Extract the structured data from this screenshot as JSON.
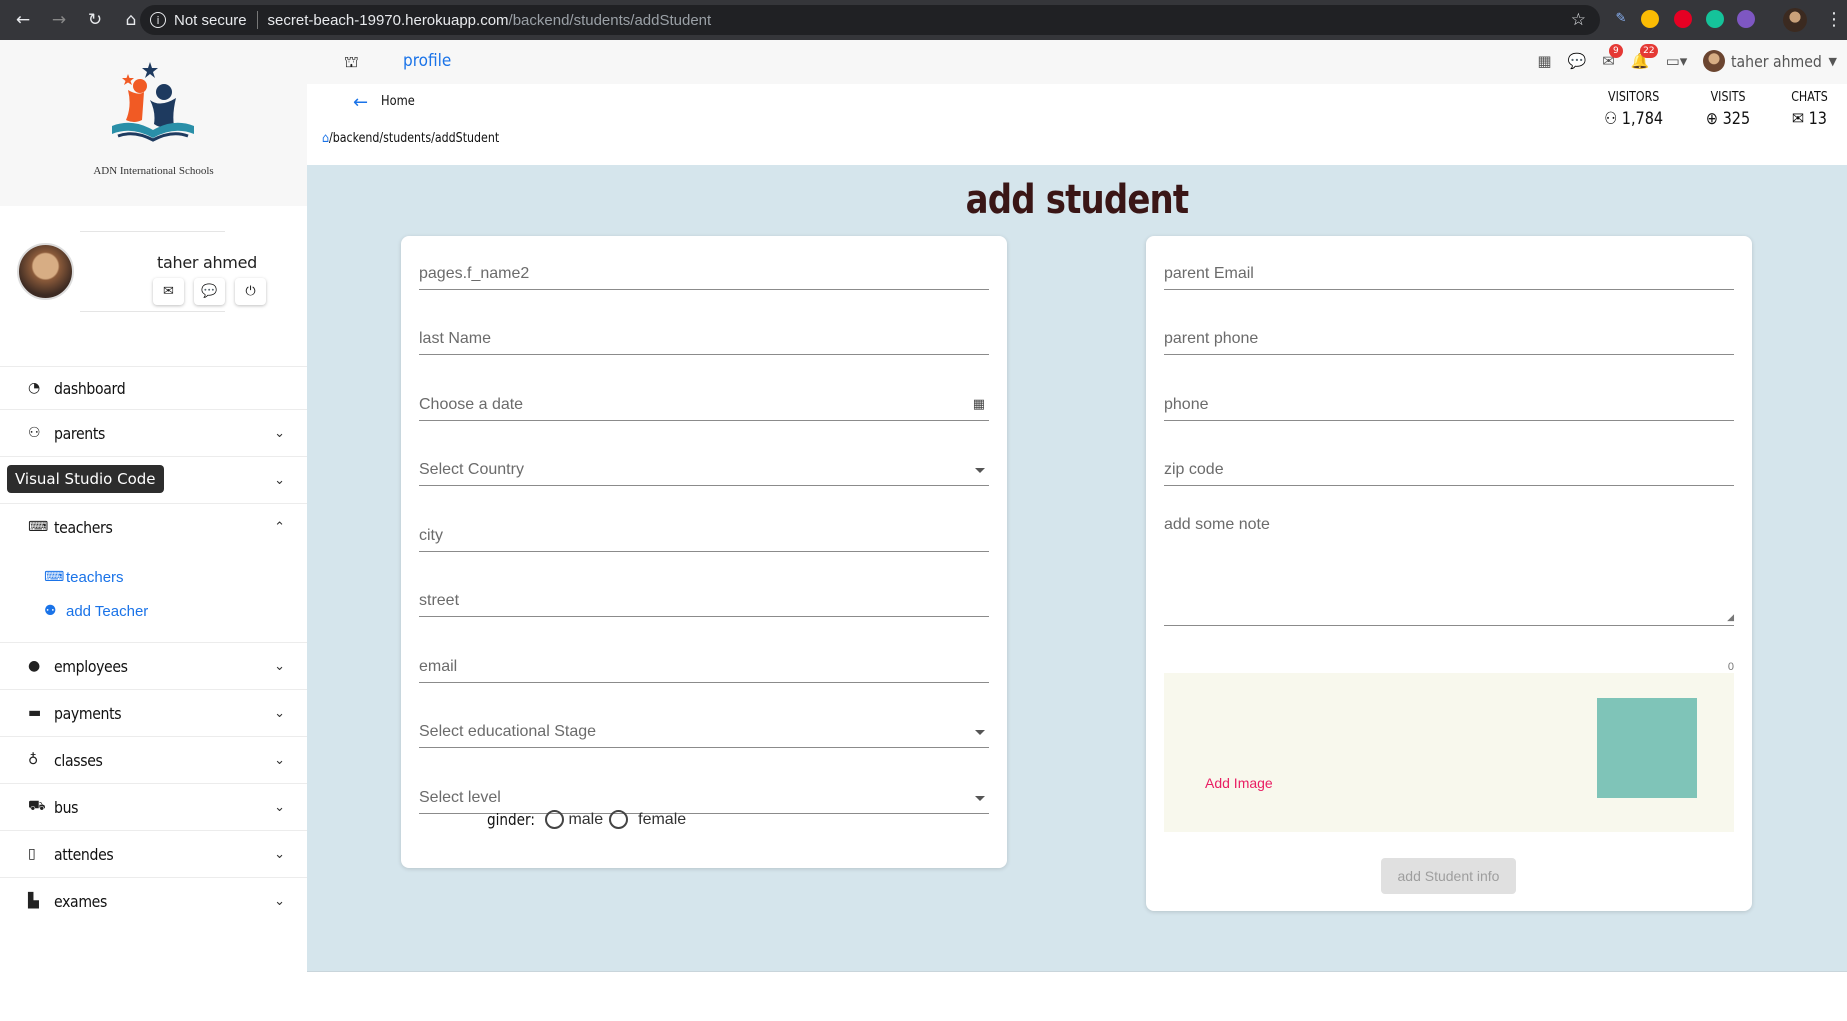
{
  "browser": {
    "security_label": "Not secure",
    "url_host": "secret-beach-19970.herokuapp.com",
    "url_path": "/backend/students/addStudent"
  },
  "sidebar": {
    "school_name": "ADN International Schools",
    "user_name": "taher ahmed",
    "tooltip": "Visual Studio Code",
    "menu": [
      {
        "label": "dashboard",
        "icon": "gauge-icon",
        "glyph": "◔",
        "chevron": ""
      },
      {
        "label": "parents",
        "icon": "users-icon",
        "glyph": "⚇",
        "chevron": "⌄"
      },
      {
        "label": "",
        "icon": "",
        "glyph": "",
        "chevron": "⌄"
      },
      {
        "label": "teachers",
        "icon": "chalkboard-icon",
        "glyph": "⌨",
        "chevron": "⌃"
      },
      {
        "label": "employees",
        "icon": "person-icon",
        "glyph": "●",
        "chevron": "⌄"
      },
      {
        "label": "payments",
        "icon": "wallet-icon",
        "glyph": "▬",
        "chevron": "⌄"
      },
      {
        "label": "classes",
        "icon": "lightbulb-icon",
        "glyph": "♁",
        "chevron": "⌄"
      },
      {
        "label": "bus",
        "icon": "bus-icon",
        "glyph": "⛟",
        "chevron": "⌄"
      },
      {
        "label": "attendes",
        "icon": "clipboard-icon",
        "glyph": "▯",
        "chevron": "⌄"
      },
      {
        "label": "exames",
        "icon": "file-export-icon",
        "glyph": "▙",
        "chevron": "⌄"
      }
    ],
    "teachers_sub": [
      {
        "label": "teachers",
        "glyph": "⌨"
      },
      {
        "label": "add Teacher",
        "glyph": "⚉"
      }
    ]
  },
  "topbar": {
    "profile_label": "profile",
    "mail_badge": "9",
    "bell_badge": "22",
    "user_name": "taher ahmed"
  },
  "header": {
    "home_label": "Home",
    "breadcrumb": "/backend/students/addStudent",
    "stats": [
      {
        "label": "VISITORS",
        "value": "1,784",
        "glyph": "⚇"
      },
      {
        "label": "VISITS",
        "value": "325",
        "glyph": "⊕"
      },
      {
        "label": "CHATS",
        "value": "13",
        "glyph": "✉"
      }
    ]
  },
  "form": {
    "title": "add student",
    "left_fields": [
      {
        "placeholder": "pages.f_name2",
        "kind": "text"
      },
      {
        "placeholder": "last Name",
        "kind": "text"
      },
      {
        "placeholder": "Choose a date",
        "kind": "date"
      },
      {
        "placeholder": "Select Country",
        "kind": "select"
      },
      {
        "placeholder": "city",
        "kind": "text"
      },
      {
        "placeholder": "street",
        "kind": "text"
      },
      {
        "placeholder": "email",
        "kind": "text"
      },
      {
        "placeholder": "Select educational Stage",
        "kind": "select"
      },
      {
        "placeholder": "Select level",
        "kind": "select"
      }
    ],
    "gender_label": "ginder:",
    "gender_options": [
      "male",
      "female"
    ],
    "right_fields": [
      {
        "placeholder": "parent Email"
      },
      {
        "placeholder": "parent phone"
      },
      {
        "placeholder": "phone"
      },
      {
        "placeholder": "zip code"
      }
    ],
    "note_placeholder": "add some note",
    "note_counter": "0",
    "add_image_label": "Add Image",
    "submit_label": "add Student info"
  }
}
